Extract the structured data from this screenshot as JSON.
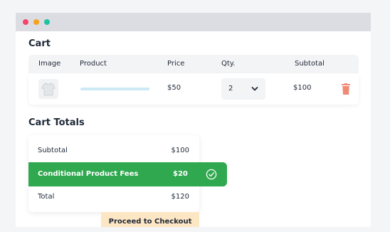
{
  "window": {
    "controls": {
      "close_color": "#f5436b",
      "minimize_color": "#f6a21c",
      "maximize_color": "#1fc3a0"
    }
  },
  "cart": {
    "title": "Cart",
    "columns": [
      "Image",
      "Product",
      "Price",
      "Qty.",
      "Subtotal"
    ],
    "items": [
      {
        "image_icon": "shirt-icon",
        "price": "$50",
        "qty": "2",
        "subtotal": "$100",
        "remove_icon": "trash-icon"
      }
    ]
  },
  "totals": {
    "title": "Cart Totals",
    "subtotal_label": "Subtotal",
    "subtotal_value": "$100",
    "fees_label": "Conditional Product Fees",
    "fees_value": "$20",
    "fees_icon": "check-circle-icon",
    "total_label": "Total",
    "total_value": "$120",
    "checkout_label": "Proceed to Checkout"
  },
  "colors": {
    "accent_green": "#2fa84f",
    "checkout_bg": "#fde6c4",
    "trash": "#f08a74"
  }
}
